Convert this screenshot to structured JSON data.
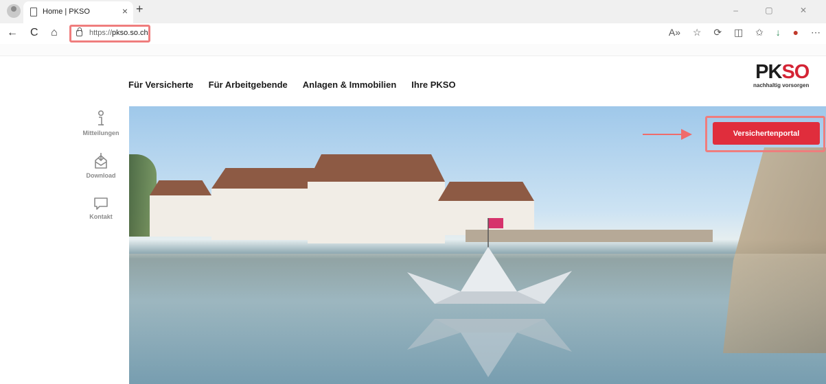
{
  "browser": {
    "tab_title": "Home | PKSO",
    "tab_close": "×",
    "new_tab": "+",
    "url_prefix": "https://",
    "url_domain": "pkso.so.ch",
    "nav": {
      "back": "←",
      "reload": "C",
      "home": "⌂"
    }
  },
  "header": {
    "nav_items": [
      "Für Versicherte",
      "Für Arbeitgebende",
      "Anlagen & Immobilien",
      "Ihre PKSO"
    ],
    "logo": {
      "pk": "PK",
      "so": "SO",
      "tagline": "nachhaltig vorsorgen"
    }
  },
  "sidebar": {
    "items": [
      {
        "label": "Mitteilungen",
        "icon": "info-icon"
      },
      {
        "label": "Download",
        "icon": "download-icon"
      },
      {
        "label": "Kontakt",
        "icon": "chat-icon"
      }
    ]
  },
  "hero": {
    "cta_label": "Versichertenportal"
  },
  "colors": {
    "brand_red": "#e02d3c",
    "highlight": "#ef7d7d",
    "nav_text": "#1b1b1b"
  }
}
